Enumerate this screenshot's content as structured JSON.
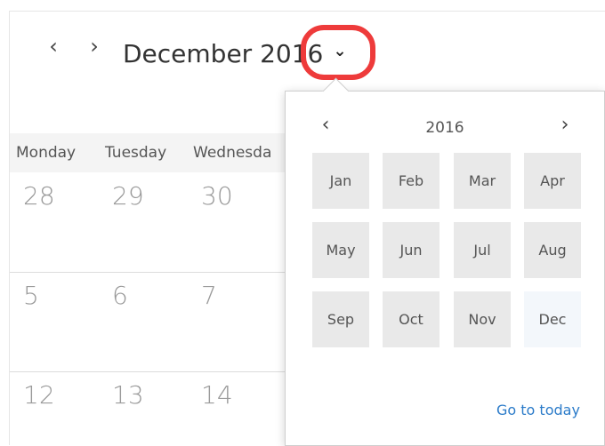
{
  "header": {
    "prev_label": "‹",
    "next_label": "›",
    "title": "December 2016",
    "dropdown_label": "⌄"
  },
  "weekdays": [
    "Monday",
    "Tuesday",
    "Wednesda"
  ],
  "days": [
    [
      "28",
      "29",
      "30"
    ],
    [
      "5",
      "6",
      "7"
    ],
    [
      "12",
      "13",
      "14"
    ]
  ],
  "picker": {
    "prev_label": "‹",
    "next_label": "›",
    "year": "2016",
    "months": [
      "Jan",
      "Feb",
      "Mar",
      "Apr",
      "May",
      "Jun",
      "Jul",
      "Aug",
      "Sep",
      "Oct",
      "Nov",
      "Dec"
    ],
    "selected_month": "Dec",
    "today_link": "Go to today"
  },
  "colors": {
    "highlight": "#ee3b3b",
    "link": "#2b7bc9",
    "month_tile": "#e9e9e9",
    "selected_tile": "#f3f7fb"
  }
}
